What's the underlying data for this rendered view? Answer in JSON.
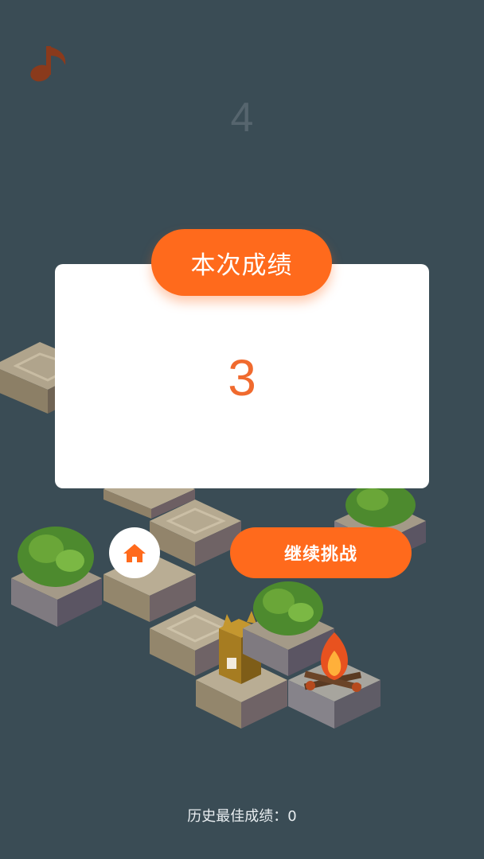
{
  "game": {
    "music_icon": "music-note-icon",
    "background_score": "4"
  },
  "result": {
    "title": "本次成绩",
    "score": "3"
  },
  "actions": {
    "home_icon": "home-icon",
    "continue_label": "继续挑战"
  },
  "footer": {
    "best_score": "历史最佳成绩：0"
  },
  "colors": {
    "background": "#3a4c55",
    "accent": "#ff6a1c",
    "score_text": "#f06a2e",
    "music_icon": "#8a3a1c"
  }
}
